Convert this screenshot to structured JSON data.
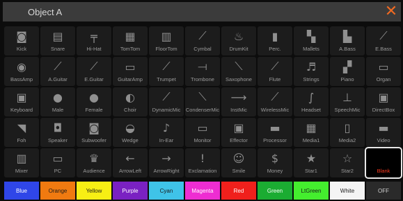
{
  "window": {
    "title": "Object A",
    "close_symbol": "✕"
  },
  "icons": [
    {
      "label": "Kick",
      "icon": "kick-drum-icon",
      "glyph": "◙"
    },
    {
      "label": "Snare",
      "icon": "snare-drum-icon",
      "glyph": "▤"
    },
    {
      "label": "Hi-Hat",
      "icon": "hihat-icon",
      "glyph": "╤"
    },
    {
      "label": "TomTom",
      "icon": "tomtom-icon",
      "glyph": "▦"
    },
    {
      "label": "FloorTom",
      "icon": "floortom-icon",
      "glyph": "▥"
    },
    {
      "label": "Cymbal",
      "icon": "cymbal-icon",
      "glyph": "⟋"
    },
    {
      "label": "DrumKit",
      "icon": "drumkit-icon",
      "glyph": "♨"
    },
    {
      "label": "Perc.",
      "icon": "percussion-icon",
      "glyph": "▮"
    },
    {
      "label": "Mallets",
      "icon": "mallets-icon",
      "glyph": "▚"
    },
    {
      "label": "A.Bass",
      "icon": "amp-bass-icon",
      "glyph": "▙"
    },
    {
      "label": "E.Bass",
      "icon": "electric-bass-icon",
      "glyph": "⟋"
    },
    {
      "label": "BassAmp",
      "icon": "bass-amp-icon",
      "glyph": "◉"
    },
    {
      "label": "A.Guitar",
      "icon": "acoustic-guitar-icon",
      "glyph": "⟋"
    },
    {
      "label": "E.Guitar",
      "icon": "electric-guitar-icon",
      "glyph": "⟋"
    },
    {
      "label": "GuitarAmp",
      "icon": "guitar-amp-icon",
      "glyph": "▭"
    },
    {
      "label": "Trumpet",
      "icon": "trumpet-icon",
      "glyph": "⟋"
    },
    {
      "label": "Trombone",
      "icon": "trombone-icon",
      "glyph": "⟞"
    },
    {
      "label": "Saxophone",
      "icon": "saxophone-icon",
      "glyph": "⟍"
    },
    {
      "label": "Flute",
      "icon": "flute-icon",
      "glyph": "⟋"
    },
    {
      "label": "Strings",
      "icon": "strings-icon",
      "glyph": "♬"
    },
    {
      "label": "Piano",
      "icon": "piano-icon",
      "glyph": "▞"
    },
    {
      "label": "Organ",
      "icon": "organ-icon",
      "glyph": "▭"
    },
    {
      "label": "Keyboard",
      "icon": "keyboard-icon",
      "glyph": "▣"
    },
    {
      "label": "Male",
      "icon": "male-head-icon",
      "glyph": "●"
    },
    {
      "label": "Female",
      "icon": "female-head-icon",
      "glyph": "●"
    },
    {
      "label": "Choir",
      "icon": "choir-icon",
      "glyph": "◐"
    },
    {
      "label": "DynamicMic",
      "icon": "dynamic-mic-icon",
      "glyph": "⟋"
    },
    {
      "label": "CondenserMic",
      "icon": "condenser-mic-icon",
      "glyph": "⟍"
    },
    {
      "label": "InstMic",
      "icon": "instrument-mic-icon",
      "glyph": "⟶"
    },
    {
      "label": "WirelessMic",
      "icon": "wireless-mic-icon",
      "glyph": "⟋"
    },
    {
      "label": "Headset",
      "icon": "headset-icon",
      "glyph": "∫"
    },
    {
      "label": "SpeechMic",
      "icon": "speech-mic-icon",
      "glyph": "⊥"
    },
    {
      "label": "DirectBox",
      "icon": "direct-box-icon",
      "glyph": "▣"
    },
    {
      "label": "Foh",
      "icon": "foh-speaker-icon",
      "glyph": "◥"
    },
    {
      "label": "Speaker",
      "icon": "speaker-icon",
      "glyph": "◘"
    },
    {
      "label": "Subwoofer",
      "icon": "subwoofer-icon",
      "glyph": "◙"
    },
    {
      "label": "Wedge",
      "icon": "wedge-monitor-icon",
      "glyph": "◒"
    },
    {
      "label": "In-Ear",
      "icon": "in-ear-icon",
      "glyph": "♪"
    },
    {
      "label": "Monitor",
      "icon": "monitor-icon",
      "glyph": "▭"
    },
    {
      "label": "Effector",
      "icon": "effector-icon",
      "glyph": "▣"
    },
    {
      "label": "Processor",
      "icon": "processor-icon",
      "glyph": "▬"
    },
    {
      "label": "Media1",
      "icon": "media1-icon",
      "glyph": "▦"
    },
    {
      "label": "Media2",
      "icon": "media2-icon",
      "glyph": "▯"
    },
    {
      "label": "Video",
      "icon": "video-icon",
      "glyph": "▬"
    },
    {
      "label": "Mixer",
      "icon": "mixer-icon",
      "glyph": "▥"
    },
    {
      "label": "PC",
      "icon": "laptop-icon",
      "glyph": "▭"
    },
    {
      "label": "Audience",
      "icon": "audience-icon",
      "glyph": "♛"
    },
    {
      "label": "ArrowLeft",
      "icon": "arrow-left-icon",
      "glyph": "←"
    },
    {
      "label": "ArrowRight",
      "icon": "arrow-right-icon",
      "glyph": "→"
    },
    {
      "label": "Exclamation",
      "icon": "exclamation-icon",
      "glyph": "!"
    },
    {
      "label": "Smile",
      "icon": "smile-icon",
      "glyph": "☺"
    },
    {
      "label": "Money",
      "icon": "money-icon",
      "glyph": "$"
    },
    {
      "label": "Star1",
      "icon": "star-filled-icon",
      "glyph": "★"
    },
    {
      "label": "Star2",
      "icon": "star-outline-icon",
      "glyph": "☆"
    },
    {
      "label": "Blank",
      "icon": "blank-icon",
      "glyph": ""
    }
  ],
  "selected_label": "Blank",
  "colors": [
    {
      "label": "Blue",
      "bg": "#2f46e8",
      "fg": "#ffffff"
    },
    {
      "label": "Orange",
      "bg": "#f07a10",
      "fg": "#1a1a1a"
    },
    {
      "label": "Yellow",
      "bg": "#f7ef14",
      "fg": "#1a1a1a"
    },
    {
      "label": "Purple",
      "bg": "#7a21c2",
      "fg": "#ffffff"
    },
    {
      "label": "Cyan",
      "bg": "#3fc3e8",
      "fg": "#1a1a1a"
    },
    {
      "label": "Magenta",
      "bg": "#ee2dd2",
      "fg": "#ffffff"
    },
    {
      "label": "Red",
      "bg": "#f0201c",
      "fg": "#ffffff"
    },
    {
      "label": "Green",
      "bg": "#1bac32",
      "fg": "#ffffff"
    },
    {
      "label": "LtGreen",
      "bg": "#44ee2e",
      "fg": "#1a1a1a"
    },
    {
      "label": "White",
      "bg": "#f4f4f4",
      "fg": "#1a1a1a"
    },
    {
      "label": "OFF",
      "bg": "#2a2a2a",
      "fg": "#d0d0d0"
    }
  ]
}
